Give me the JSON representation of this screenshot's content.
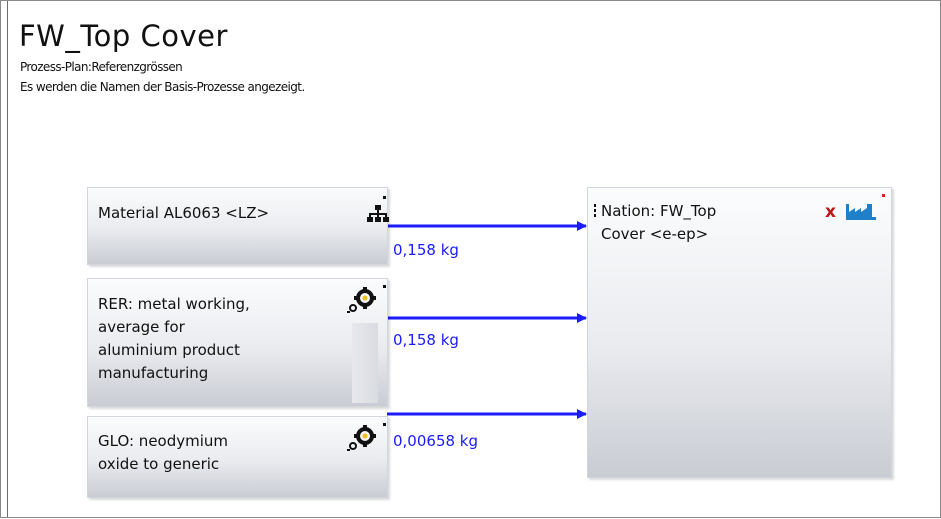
{
  "title": "FW_Top Cover",
  "subtitle_line1": "Prozess-Plan:Referenzgrössen",
  "subtitle_line2": "Es werden die Namen der Basis-Prozesse angezeigt.",
  "processes": [
    {
      "lines": [
        "Material AL6063 <LZ>"
      ],
      "icon": "hierarchy-icon"
    },
    {
      "lines": [
        "RER: metal working,",
        "average for",
        "aluminium product",
        "manufacturing"
      ],
      "icon": "gear-icon"
    },
    {
      "lines": [
        "GLO: neodymium",
        "oxide to generic"
      ],
      "icon": "gear-icon"
    }
  ],
  "target": {
    "lines": [
      "Nation: FW_Top",
      "Cover <e-ep>"
    ],
    "icons": [
      "red-x-icon",
      "factory-icon"
    ]
  },
  "flows": [
    {
      "label": "0,158 kg"
    },
    {
      "label": "0,158 kg"
    },
    {
      "label": "0,00658 kg"
    }
  ],
  "colors": {
    "arrow": "#1b1bff",
    "flow_label": "#1b1bff",
    "red_icon": "#c0151b",
    "factory": "#1f7fc9"
  }
}
